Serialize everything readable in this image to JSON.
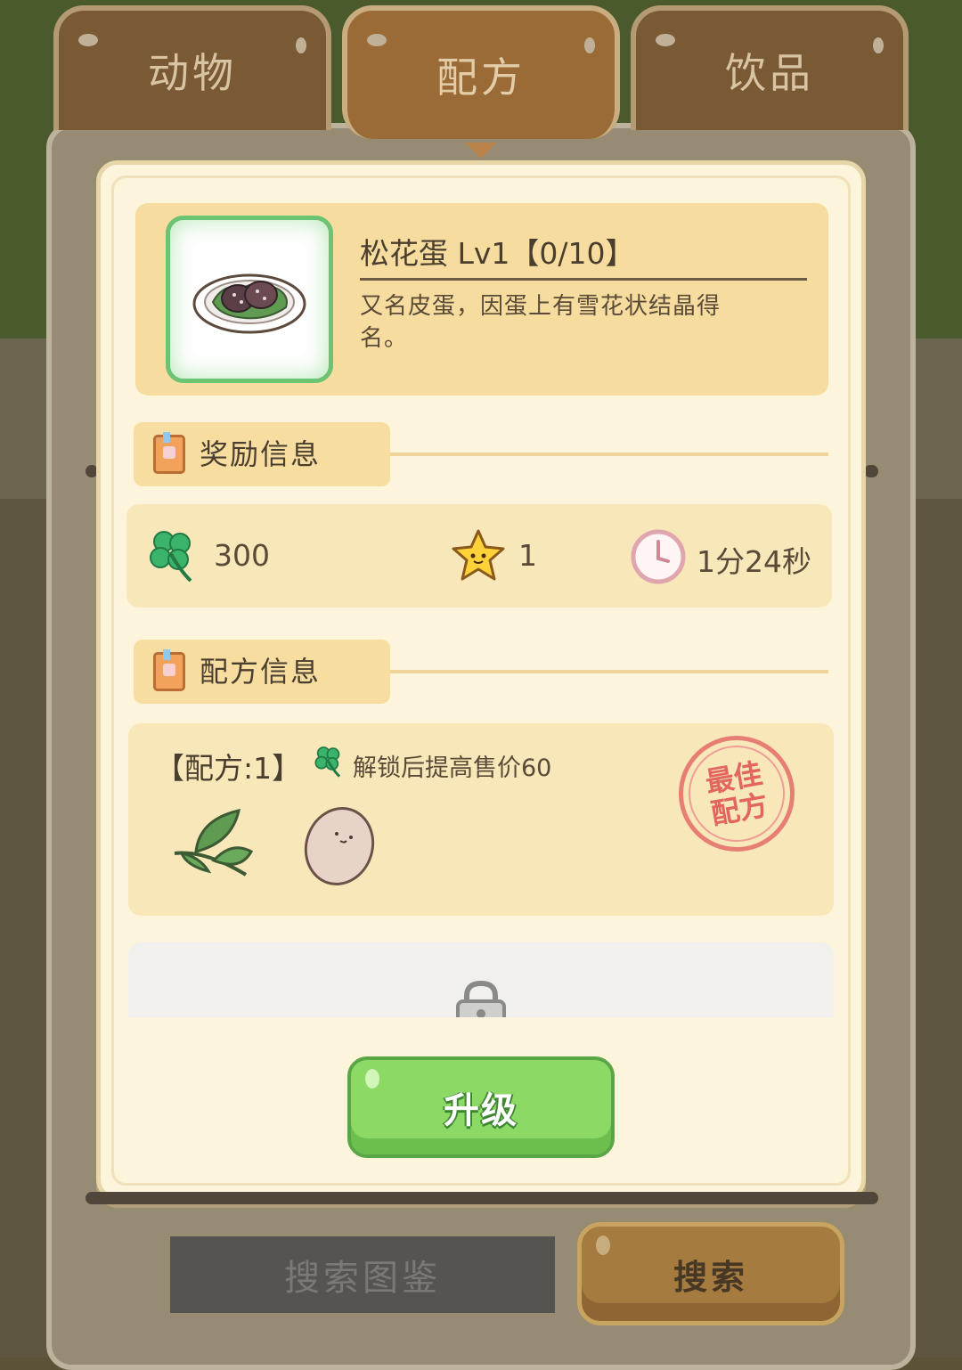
{
  "tabs": [
    {
      "label": "动物",
      "active": false
    },
    {
      "label": "配方",
      "active": true
    },
    {
      "label": "饮品",
      "active": false
    }
  ],
  "item": {
    "title": "松花蛋 Lv1【0/10】",
    "description": "又名皮蛋，因蛋上有雪花状结晶得名。"
  },
  "reward_section": {
    "label": "奖励信息",
    "clover_value": "300",
    "star_value": "1",
    "time_value": "1分24秒"
  },
  "recipe_section": {
    "label": "配方信息",
    "recipe_number": "【配方:1】",
    "bonus_text": "解锁后提高售价60",
    "stamp_line1": "最佳",
    "stamp_line2": "配方",
    "ingredients": [
      "leaf-icon",
      "egg-icon"
    ]
  },
  "upgrade_button": "升级",
  "bottom": {
    "search_book_label": "搜索图鉴",
    "search_label": "搜索"
  },
  "colors": {
    "accent_green": "#8dd966",
    "clover_green": "#3bb36a",
    "stamp_red": "#e2665f",
    "tab_brown": "#9a6b36"
  }
}
